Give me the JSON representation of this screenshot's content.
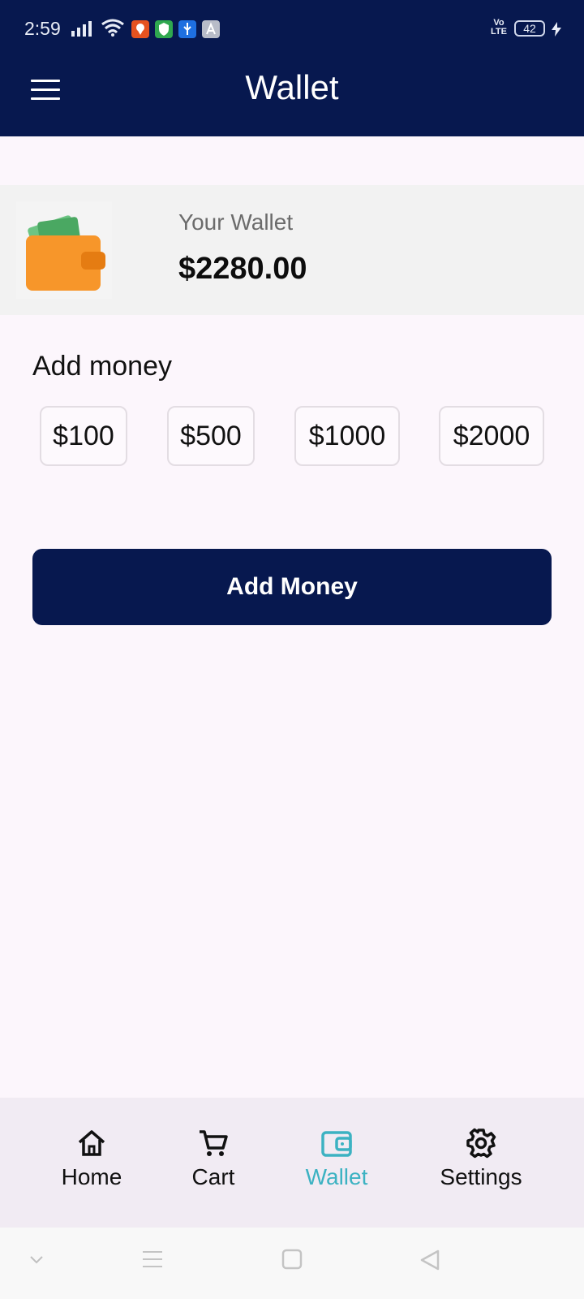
{
  "status_bar": {
    "time": "2:59",
    "network_label": "Vo LTE",
    "battery": "42",
    "notification_icons": [
      "location-app-icon",
      "shield-app-icon",
      "usb-icon",
      "app-store-icon"
    ]
  },
  "app_bar": {
    "title": "Wallet",
    "menu_icon": "hamburger-menu-icon"
  },
  "wallet": {
    "label": "Your Wallet",
    "balance": "$2280.00",
    "image": "wallet-illustration"
  },
  "add_money": {
    "section_title": "Add money",
    "amounts": [
      "$100",
      "$500",
      "$1000",
      "$2000"
    ],
    "button_label": "Add Money"
  },
  "bottom_nav": {
    "items": [
      {
        "label": "Home",
        "icon": "home-icon"
      },
      {
        "label": "Cart",
        "icon": "cart-icon"
      },
      {
        "label": "Wallet",
        "icon": "wallet-icon",
        "active": true
      },
      {
        "label": "Settings",
        "icon": "gear-icon"
      }
    ]
  },
  "system_nav": {
    "keys": [
      "chevron-down-icon",
      "recent-apps-icon",
      "home-square-icon",
      "back-triangle-icon"
    ]
  },
  "colors": {
    "primary": "#07184f",
    "accent_active": "#3cb2c2",
    "background": "#fcf6fc",
    "card": "#f2f2f2",
    "nav_background": "#f1ebf3"
  }
}
